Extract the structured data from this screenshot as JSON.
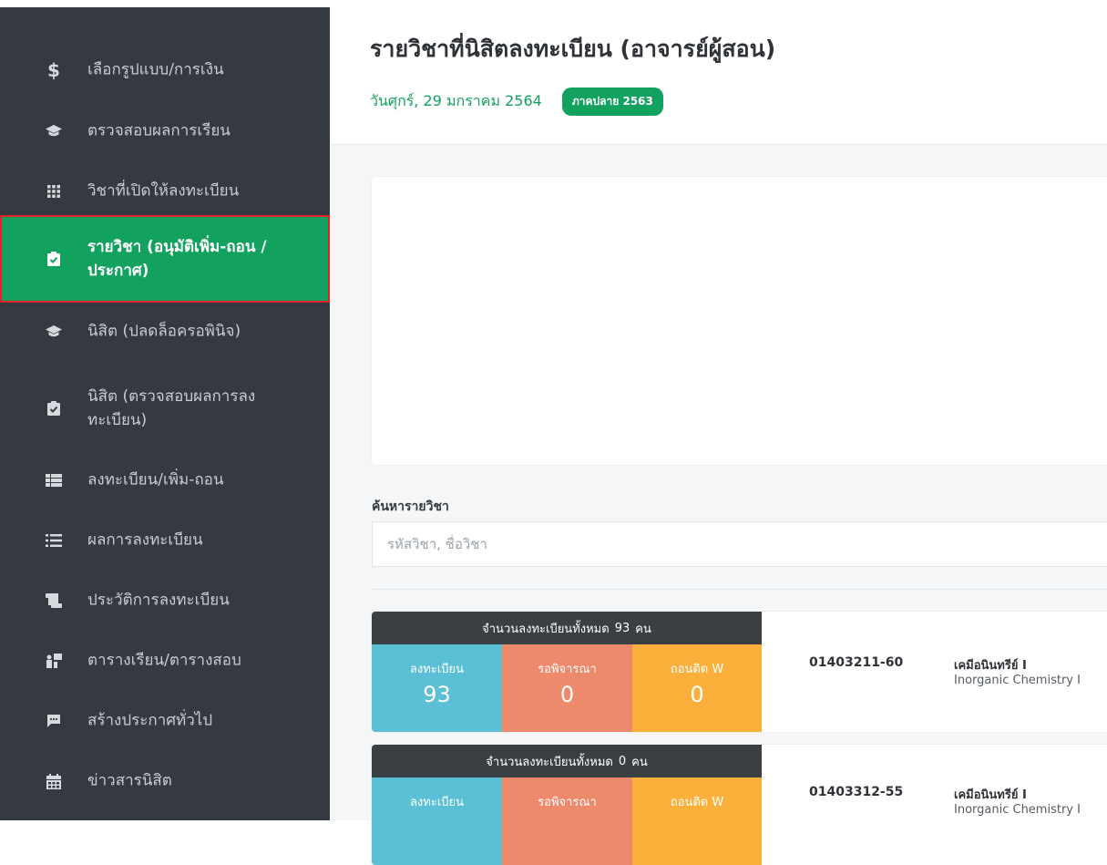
{
  "sidebar": {
    "items": [
      {
        "label": "เลือกรูปแบบ/การเงิน",
        "icon": "dollar-icon",
        "glyph": "$"
      },
      {
        "label": "ตรวจสอบผลการเรียน",
        "icon": "graduation-cap-icon",
        "glyph": "🎓"
      },
      {
        "label": "วิชาที่เปิดให้ลงทะเบียน",
        "icon": "grid-icon",
        "glyph": "▦"
      },
      {
        "label": "รายวิชา (อนุมัติเพิ่ม-ถอน / ประกาศ)",
        "icon": "clipboard-check-icon",
        "glyph": "☑",
        "active": true
      },
      {
        "label": "นิสิต (ปลดล็อครอพินิจ)",
        "icon": "graduation-cap-icon",
        "glyph": "🎓"
      },
      {
        "label": "นิสิต (ตรวจสอบผลการลงทะเบียน)",
        "icon": "clipboard-check-icon",
        "glyph": "☑"
      },
      {
        "label": "ลงทะเบียน/เพิ่ม-ถอน",
        "icon": "table-list-icon",
        "glyph": "▤"
      },
      {
        "label": "ผลการลงทะเบียน",
        "icon": "list-icon",
        "glyph": "☰"
      },
      {
        "label": "ประวัติการลงทะเบียน",
        "icon": "scroll-icon",
        "glyph": "📜"
      },
      {
        "label": "ตารางเรียน/ตารางสอบ",
        "icon": "chalkboard-teacher-icon",
        "glyph": "👤"
      },
      {
        "label": "สร้างประกาศทั่วไป",
        "icon": "comment-icon",
        "glyph": "💬"
      },
      {
        "label": "ข่าวสารนิสิต",
        "icon": "calendar-icon",
        "glyph": "📅"
      }
    ]
  },
  "header": {
    "title": "รายวิชาที่นิสิตลงทะเบียน (อาจารย์ผู้สอน)",
    "date": "วันศุกร์, 29 มกราคม 2564",
    "term_badge": "ภาคปลาย 2563"
  },
  "search": {
    "label": "ค้นหารายวิชา",
    "placeholder": "รหัสวิชา, ชื่อวิชา",
    "value": ""
  },
  "courses": [
    {
      "total_prefix": "จำนวนลงทะเบียนทั้งหมด",
      "total": "93",
      "total_suffix": "คน",
      "registered_label": "ลงทะเบียน",
      "registered": "93",
      "pending_label": "รอพิจารณา",
      "pending": "0",
      "withdrawn_label": "ถอนติด W",
      "withdrawn": "0",
      "code": "01403211-60",
      "name_th": "เคมีอนินทรีย์ I",
      "name_en": "Inorganic Chemistry I"
    },
    {
      "total_prefix": "จำนวนลงทะเบียนทั้งหมด",
      "total": "0",
      "total_suffix": "คน",
      "registered_label": "ลงทะเบียน",
      "registered": "",
      "pending_label": "รอพิจารณา",
      "pending": "",
      "withdrawn_label": "ถอนติด W",
      "withdrawn": "",
      "code": "01403312-55",
      "name_th": "เคมีอนินทรีย์ I",
      "name_en": "Inorganic Chemistry I"
    }
  ],
  "colors": {
    "sidebar_bg": "#353a40",
    "accent_green": "#12a15e",
    "highlight_border": "#e32129",
    "stat_registered": "#5bc0d6",
    "stat_pending": "#ee8a6c",
    "stat_withdrawn": "#fbb03b"
  }
}
